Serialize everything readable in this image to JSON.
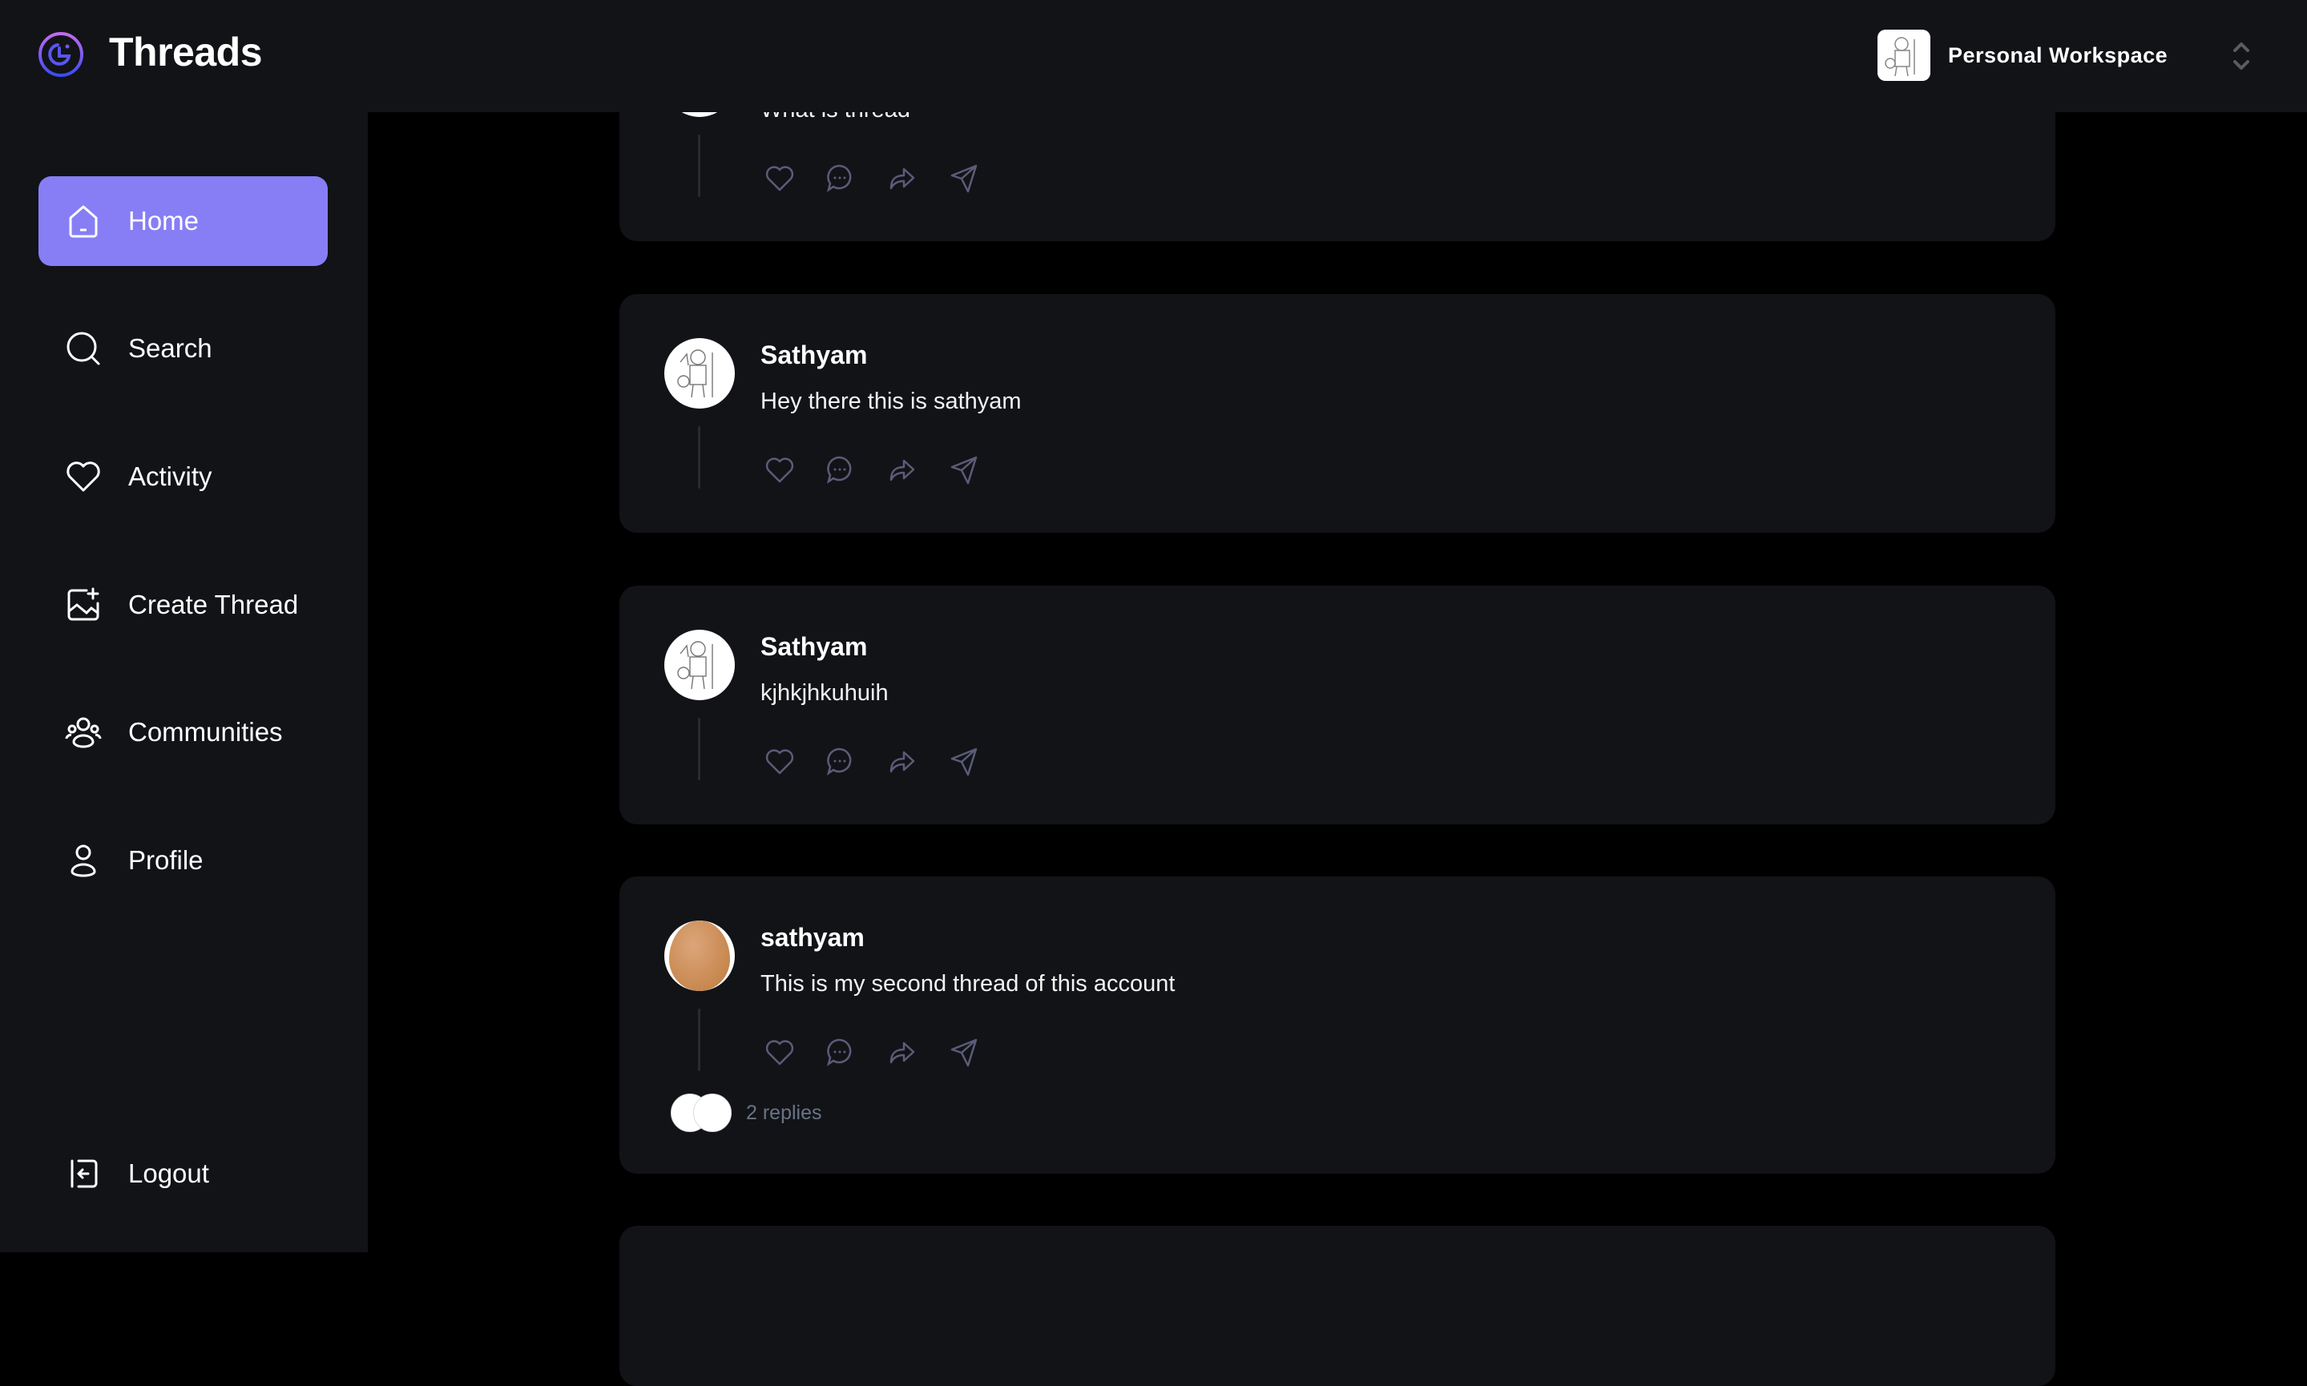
{
  "app": {
    "title": "Threads",
    "accent": "#877ef6"
  },
  "workspace": {
    "label": "Personal Workspace",
    "icon": "chevrons-up-down-icon"
  },
  "sidebar": {
    "items": [
      {
        "label": "Home",
        "icon": "home-icon",
        "active": true
      },
      {
        "label": "Search",
        "icon": "search-icon"
      },
      {
        "label": "Activity",
        "icon": "heart-icon"
      },
      {
        "label": "Create Thread",
        "icon": "image-plus-icon"
      },
      {
        "label": "Communities",
        "icon": "users-icon"
      },
      {
        "label": "Profile",
        "icon": "user-icon"
      }
    ],
    "logout": {
      "label": "Logout",
      "icon": "logout-icon"
    }
  },
  "threads": [
    {
      "author": "",
      "text": "What is thread",
      "avatar": "sketch"
    },
    {
      "author": "Sathyam",
      "text": "Hey there this is sathyam",
      "avatar": "sketch"
    },
    {
      "author": "Sathyam",
      "text": "kjhkjhkuhuih",
      "avatar": "sketch"
    },
    {
      "author": "sathyam",
      "text": "This is my second thread of this account",
      "avatar": "egg",
      "replies": "2 replies"
    }
  ],
  "actions": [
    "heart-icon",
    "comment-icon",
    "repost-icon",
    "send-icon"
  ]
}
